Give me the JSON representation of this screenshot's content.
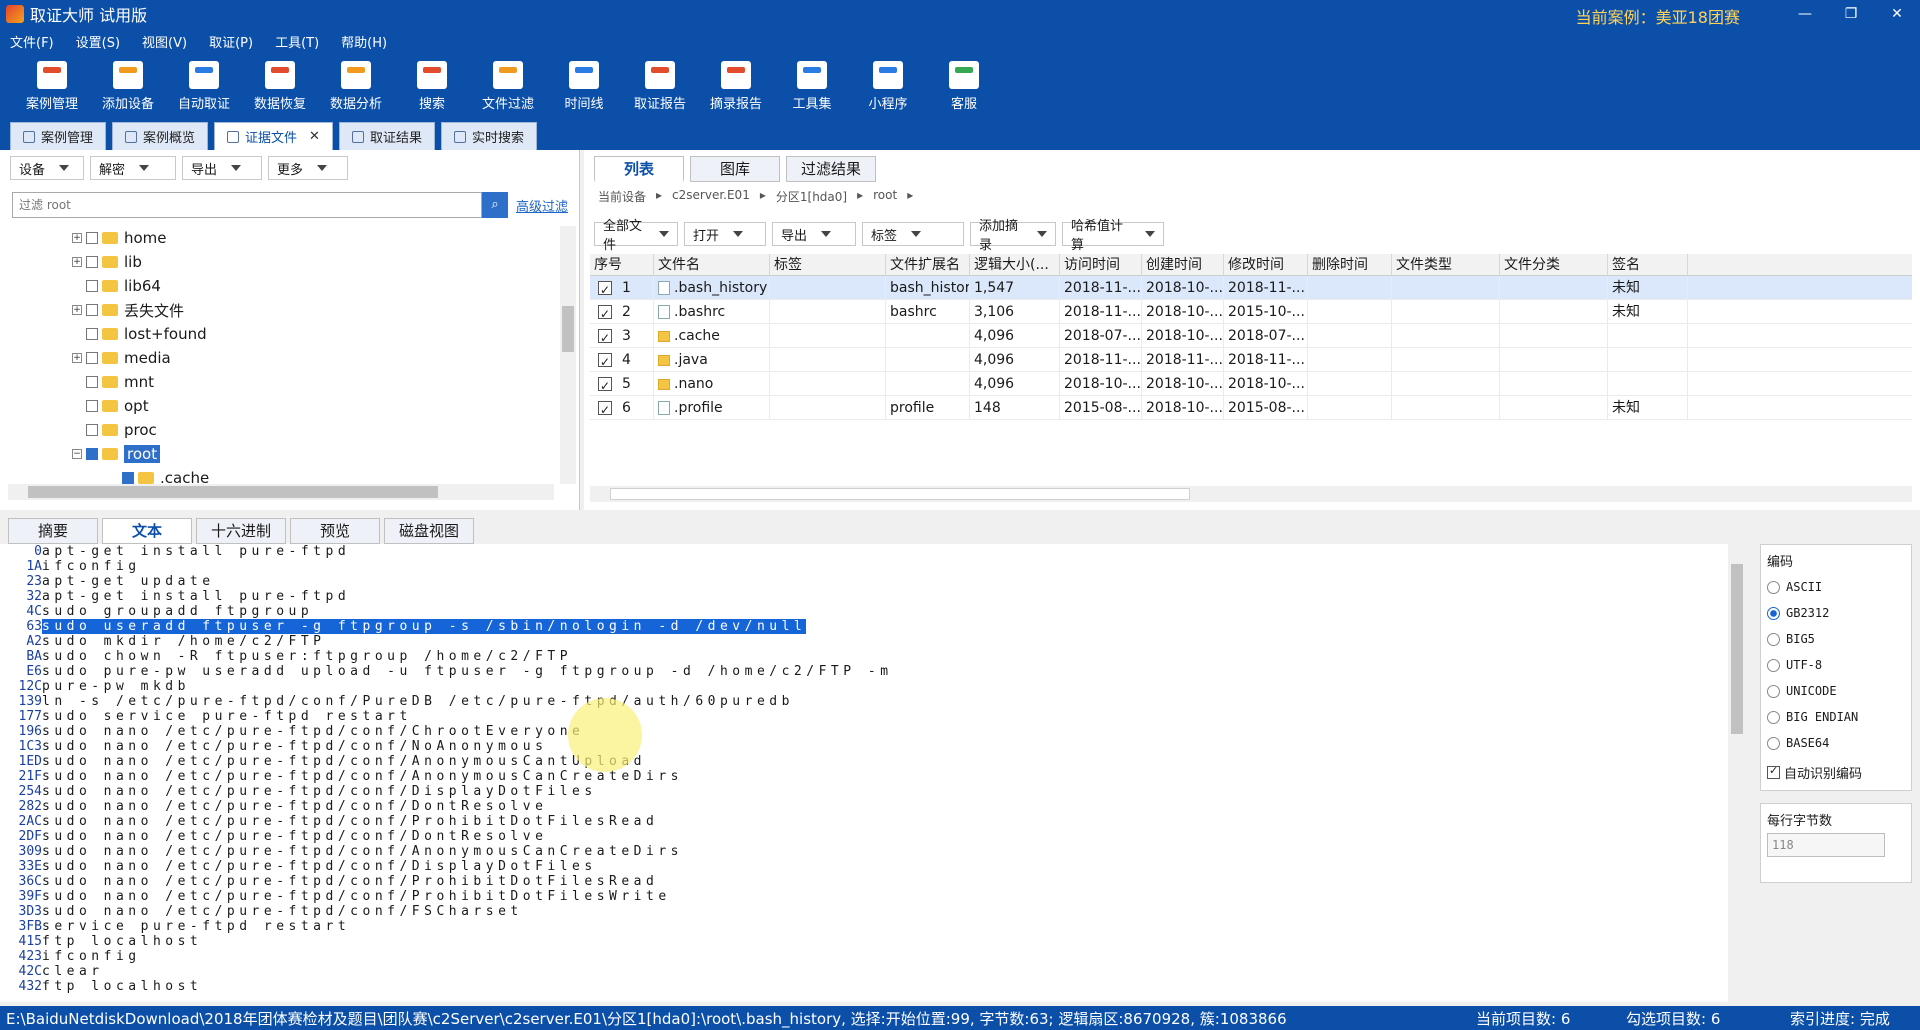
{
  "window": {
    "title": "取证大师 试用版",
    "current_case": "当前案例：美亚18团赛",
    "min": "—",
    "max": "❐",
    "close": "✕"
  },
  "menu": [
    "文件(F)",
    "设置(S)",
    "视图(V)",
    "取证(P)",
    "工具(T)",
    "帮助(H)"
  ],
  "toolbar": [
    "案例管理",
    "添加设备",
    "自动取证",
    "数据恢复",
    "数据分析",
    "搜索",
    "文件过滤",
    "时间线",
    "取证报告",
    "摘录报告",
    "工具集",
    "小程序",
    "客服"
  ],
  "main_tabs": [
    {
      "label": "案例管理",
      "active": false
    },
    {
      "label": "案例概览",
      "active": false
    },
    {
      "label": "证据文件",
      "active": true,
      "close": "✕"
    },
    {
      "label": "取证结果",
      "active": false
    },
    {
      "label": "实时搜索",
      "active": false
    }
  ],
  "left_filters": [
    "设备",
    "解密",
    "导出",
    "更多"
  ],
  "left_search": {
    "placeholder": "过滤 root",
    "advanced": "高级过滤"
  },
  "tree": [
    {
      "label": "home",
      "indent": 2,
      "expand": "+",
      "checked": false,
      "selected": false
    },
    {
      "label": "lib",
      "indent": 2,
      "expand": "+",
      "checked": false,
      "selected": false
    },
    {
      "label": "lib64",
      "indent": 2,
      "expand": "",
      "checked": false,
      "selected": false
    },
    {
      "label": "丢失文件",
      "indent": 2,
      "expand": "+",
      "checked": false,
      "selected": false
    },
    {
      "label": "lost+found",
      "indent": 2,
      "expand": "",
      "checked": false,
      "selected": false
    },
    {
      "label": "media",
      "indent": 2,
      "expand": "+",
      "checked": false,
      "selected": false
    },
    {
      "label": "mnt",
      "indent": 2,
      "expand": "",
      "checked": false,
      "selected": false
    },
    {
      "label": "opt",
      "indent": 2,
      "expand": "",
      "checked": false,
      "selected": false
    },
    {
      "label": "proc",
      "indent": 2,
      "expand": "",
      "checked": false,
      "selected": false
    },
    {
      "label": "root",
      "indent": 2,
      "expand": "−",
      "checked": true,
      "selected": true
    },
    {
      "label": ".cache",
      "indent": 3,
      "expand": "",
      "checked": true,
      "selected": false
    }
  ],
  "right_tabs": [
    {
      "label": "列表",
      "active": true
    },
    {
      "label": "图库",
      "active": false
    },
    {
      "label": "过滤结果",
      "active": false
    }
  ],
  "breadcrumb": [
    "当前设备",
    "▸",
    "c2server.E01",
    "▸",
    "分区1[hda0]",
    "▸",
    "root",
    "▸"
  ],
  "right_tools": [
    "全部文件",
    "打开",
    "导出",
    "标签",
    "添加摘录",
    "哈希值计算"
  ],
  "grid": {
    "columns": [
      "序号",
      "文件名",
      "标签",
      "文件扩展名",
      "逻辑大小(...",
      "访问时间",
      "创建时间",
      "修改时间",
      "删除时间",
      "文件类型",
      "文件分类",
      "签名"
    ],
    "rows": [
      {
        "no": "1",
        "name": ".bash_history",
        "folder": false,
        "tag": "",
        "ext": "bash_history",
        "size": "1,547",
        "atime": "2018-11-...",
        "ctime": "2018-10-...",
        "mtime": "2018-11-...",
        "dtime": "",
        "type": "",
        "cls": "",
        "sig": "未知"
      },
      {
        "no": "2",
        "name": ".bashrc",
        "folder": false,
        "tag": "",
        "ext": "bashrc",
        "size": "3,106",
        "atime": "2018-11-...",
        "ctime": "2018-10-...",
        "mtime": "2015-10-...",
        "dtime": "",
        "type": "",
        "cls": "",
        "sig": "未知"
      },
      {
        "no": "3",
        "name": ".cache",
        "folder": true,
        "tag": "",
        "ext": "",
        "size": "4,096",
        "atime": "2018-07-...",
        "ctime": "2018-10-...",
        "mtime": "2018-07-...",
        "dtime": "",
        "type": "",
        "cls": "",
        "sig": ""
      },
      {
        "no": "4",
        "name": ".java",
        "folder": true,
        "tag": "",
        "ext": "",
        "size": "4,096",
        "atime": "2018-11-...",
        "ctime": "2018-11-...",
        "mtime": "2018-11-...",
        "dtime": "",
        "type": "",
        "cls": "",
        "sig": ""
      },
      {
        "no": "5",
        "name": ".nano",
        "folder": true,
        "tag": "",
        "ext": "",
        "size": "4,096",
        "atime": "2018-10-...",
        "ctime": "2018-10-...",
        "mtime": "2018-10-...",
        "dtime": "",
        "type": "",
        "cls": "",
        "sig": ""
      },
      {
        "no": "6",
        "name": ".profile",
        "folder": false,
        "tag": "",
        "ext": "profile",
        "size": "148",
        "atime": "2015-08-...",
        "ctime": "2018-10-...",
        "mtime": "2015-08-...",
        "dtime": "",
        "type": "",
        "cls": "",
        "sig": "未知"
      }
    ]
  },
  "bottom_tabs": [
    {
      "label": "摘要",
      "active": false
    },
    {
      "label": "文本",
      "active": true
    },
    {
      "label": "十六进制",
      "active": false
    },
    {
      "label": "预览",
      "active": false
    },
    {
      "label": "磁盘视图",
      "active": false
    }
  ],
  "text_lines": [
    {
      "off": "0",
      "txt": "apt-get install pure-ftpd",
      "hl": false
    },
    {
      "off": "1A",
      "txt": "ifconfig",
      "hl": false
    },
    {
      "off": "23",
      "txt": "apt-get update",
      "hl": false
    },
    {
      "off": "32",
      "txt": "apt-get install pure-ftpd",
      "hl": false
    },
    {
      "off": "4C",
      "txt": "sudo groupadd ftpgroup",
      "hl": false
    },
    {
      "off": "63",
      "txt": "sudo useradd ftpuser -g ftpgroup -s /sbin/nologin -d /dev/null",
      "hl": true
    },
    {
      "off": "A2",
      "txt": "sudo mkdir /home/c2/FTP",
      "hl": false
    },
    {
      "off": "BA",
      "txt": "sudo chown -R ftpuser:ftpgroup /home/c2/FTP",
      "hl": false
    },
    {
      "off": "E6",
      "txt": "sudo pure-pw useradd upload -u ftpuser -g ftpgroup -d /home/c2/FTP -m",
      "hl": false
    },
    {
      "off": "12C",
      "txt": "pure-pw mkdb",
      "hl": false
    },
    {
      "off": "139",
      "txt": "ln -s /etc/pure-ftpd/conf/PureDB /etc/pure-ftpd/auth/60puredb",
      "hl": false
    },
    {
      "off": "177",
      "txt": "sudo service pure-ftpd restart",
      "hl": false
    },
    {
      "off": "196",
      "txt": "sudo nano /etc/pure-ftpd/conf/ChrootEveryone",
      "hl": false
    },
    {
      "off": "1C3",
      "txt": "sudo nano /etc/pure-ftpd/conf/NoAnonymous",
      "hl": false
    },
    {
      "off": "1ED",
      "txt": "sudo nano /etc/pure-ftpd/conf/AnonymousCantUpload",
      "hl": false
    },
    {
      "off": "21F",
      "txt": "sudo nano /etc/pure-ftpd/conf/AnonymousCanCreateDirs",
      "hl": false
    },
    {
      "off": "254",
      "txt": "sudo nano /etc/pure-ftpd/conf/DisplayDotFiles",
      "hl": false
    },
    {
      "off": "282",
      "txt": "sudo nano /etc/pure-ftpd/conf/DontResolve",
      "hl": false
    },
    {
      "off": "2AC",
      "txt": "sudo nano /etc/pure-ftpd/conf/ProhibitDotFilesRead",
      "hl": false
    },
    {
      "off": "2DF",
      "txt": "sudo nano /etc/pure-ftpd/conf/DontResolve",
      "hl": false
    },
    {
      "off": "309",
      "txt": "sudo nano /etc/pure-ftpd/conf/AnonymousCanCreateDirs",
      "hl": false
    },
    {
      "off": "33E",
      "txt": "sudo nano /etc/pure-ftpd/conf/DisplayDotFiles",
      "hl": false
    },
    {
      "off": "36C",
      "txt": "sudo nano /etc/pure-ftpd/conf/ProhibitDotFilesRead",
      "hl": false
    },
    {
      "off": "39F",
      "txt": "sudo nano /etc/pure-ftpd/conf/ProhibitDotFilesWrite",
      "hl": false
    },
    {
      "off": "3D3",
      "txt": "sudo nano /etc/pure-ftpd/conf/FSCharset",
      "hl": false
    },
    {
      "off": "3FB",
      "txt": "service pure-ftpd restart",
      "hl": false
    },
    {
      "off": "415",
      "txt": "ftp localhost",
      "hl": false
    },
    {
      "off": "423",
      "txt": "ifconfig",
      "hl": false
    },
    {
      "off": "42C",
      "txt": "clear",
      "hl": false
    },
    {
      "off": "432",
      "txt": "ftp localhost",
      "hl": false
    }
  ],
  "encoding": {
    "title": "编码",
    "options": [
      {
        "label": "ASCII",
        "on": false
      },
      {
        "label": "GB2312",
        "on": true
      },
      {
        "label": "BIG5",
        "on": false
      },
      {
        "label": "UTF-8",
        "on": false
      },
      {
        "label": "UNICODE",
        "on": false
      },
      {
        "label": "BIG ENDIAN",
        "on": false
      },
      {
        "label": "BASE64",
        "on": false
      }
    ],
    "auto": "自动识别编码",
    "bytes_title": "每行字节数",
    "bytes_value": "118"
  },
  "status": {
    "path": "E:\\BaiduNetdiskDownload\\2018年团体赛检材及题目\\团队赛\\c2Server\\c2server.E01\\分区1[hda0]:\\root\\.bash_history, 选择:开始位置:99, 字节数:63; 逻辑扇区:8670928, 簇:1083866",
    "current_items": "当前项目数: 6",
    "selected_items": "勾选项目数: 6",
    "index": "索引进度: 完成"
  }
}
